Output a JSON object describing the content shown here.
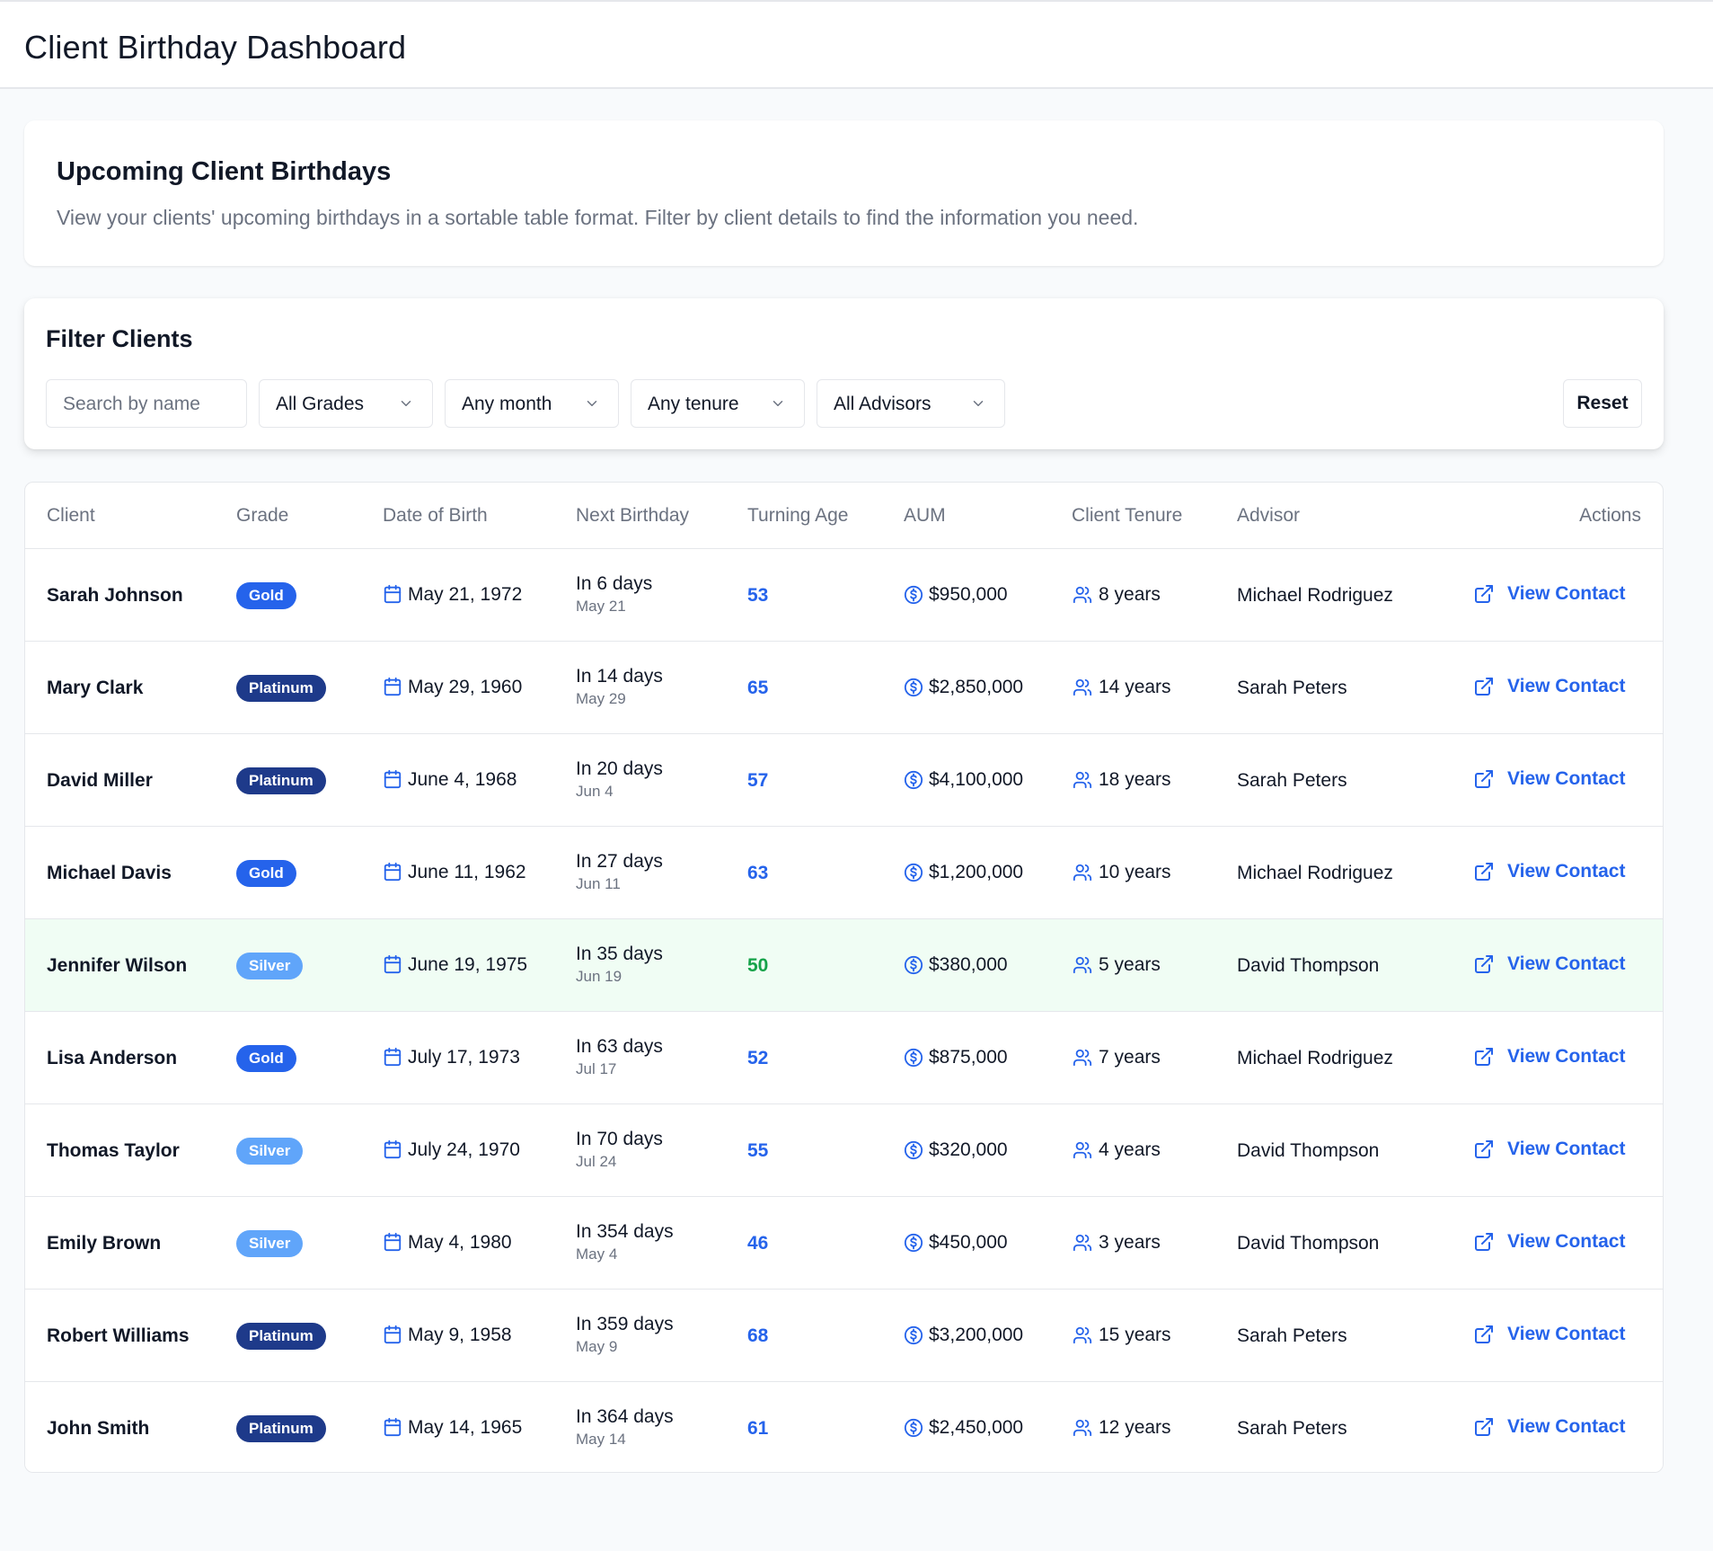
{
  "app": {
    "title": "Client Birthday Dashboard"
  },
  "intro": {
    "title": "Upcoming Client Birthdays",
    "description": "View your clients' upcoming birthdays in a sortable table format. Filter by client details to find the information you need."
  },
  "filters": {
    "title": "Filter Clients",
    "search_placeholder": "Search by name",
    "grade": "All Grades",
    "month": "Any month",
    "tenure": "Any tenure",
    "advisor": "All Advisors",
    "reset_label": "Reset"
  },
  "table": {
    "headers": {
      "client": "Client",
      "grade": "Grade",
      "dob": "Date of Birth",
      "next": "Next Birthday",
      "age": "Turning Age",
      "aum": "AUM",
      "tenure": "Client Tenure",
      "advisor": "Advisor",
      "actions": "Actions"
    },
    "action_label": "View Contact",
    "rows": [
      {
        "name": "Sarah Johnson",
        "grade": "Gold",
        "dob": "May 21, 1972",
        "next_in": "In 6 days",
        "next_date": "May 21",
        "age": "53",
        "aum": "$950,000",
        "tenure": "8 years",
        "advisor": "Michael Rodriguez"
      },
      {
        "name": "Mary Clark",
        "grade": "Platinum",
        "dob": "May 29, 1960",
        "next_in": "In 14 days",
        "next_date": "May 29",
        "age": "65",
        "aum": "$2,850,000",
        "tenure": "14 years",
        "advisor": "Sarah Peters"
      },
      {
        "name": "David Miller",
        "grade": "Platinum",
        "dob": "June 4, 1968",
        "next_in": "In 20 days",
        "next_date": "Jun 4",
        "age": "57",
        "aum": "$4,100,000",
        "tenure": "18 years",
        "advisor": "Sarah Peters"
      },
      {
        "name": "Michael Davis",
        "grade": "Gold",
        "dob": "June 11, 1962",
        "next_in": "In 27 days",
        "next_date": "Jun 11",
        "age": "63",
        "aum": "$1,200,000",
        "tenure": "10 years",
        "advisor": "Michael Rodriguez"
      },
      {
        "name": "Jennifer Wilson",
        "grade": "Silver",
        "dob": "June 19, 1975",
        "next_in": "In 35 days",
        "next_date": "Jun 19",
        "age": "50",
        "aum": "$380,000",
        "tenure": "5 years",
        "advisor": "David Thompson",
        "highlight": true
      },
      {
        "name": "Lisa Anderson",
        "grade": "Gold",
        "dob": "July 17, 1973",
        "next_in": "In 63 days",
        "next_date": "Jul 17",
        "age": "52",
        "aum": "$875,000",
        "tenure": "7 years",
        "advisor": "Michael Rodriguez"
      },
      {
        "name": "Thomas Taylor",
        "grade": "Silver",
        "dob": "July 24, 1970",
        "next_in": "In 70 days",
        "next_date": "Jul 24",
        "age": "55",
        "aum": "$320,000",
        "tenure": "4 years",
        "advisor": "David Thompson"
      },
      {
        "name": "Emily Brown",
        "grade": "Silver",
        "dob": "May 4, 1980",
        "next_in": "In 354 days",
        "next_date": "May 4",
        "age": "46",
        "aum": "$450,000",
        "tenure": "3 years",
        "advisor": "David Thompson"
      },
      {
        "name": "Robert Williams",
        "grade": "Platinum",
        "dob": "May 9, 1958",
        "next_in": "In 359 days",
        "next_date": "May 9",
        "age": "68",
        "aum": "$3,200,000",
        "tenure": "15 years",
        "advisor": "Sarah Peters"
      },
      {
        "name": "John Smith",
        "grade": "Platinum",
        "dob": "May 14, 1965",
        "next_in": "In 364 days",
        "next_date": "May 14",
        "age": "61",
        "aum": "$2,450,000",
        "tenure": "12 years",
        "advisor": "Sarah Peters"
      }
    ]
  },
  "colors": {
    "accent": "#2563eb",
    "gold_badge": "#2563eb",
    "platinum_badge": "#1e3a8a",
    "silver_badge": "#60a5fa",
    "highlight_row": "#f0fdf4",
    "highlight_age": "#16a34a"
  },
  "icons": {
    "dob": "calendar-icon",
    "aum": "dollar-circle-icon",
    "tenure": "users-icon",
    "action": "external-link-icon",
    "dropdown": "chevron-down-icon"
  }
}
